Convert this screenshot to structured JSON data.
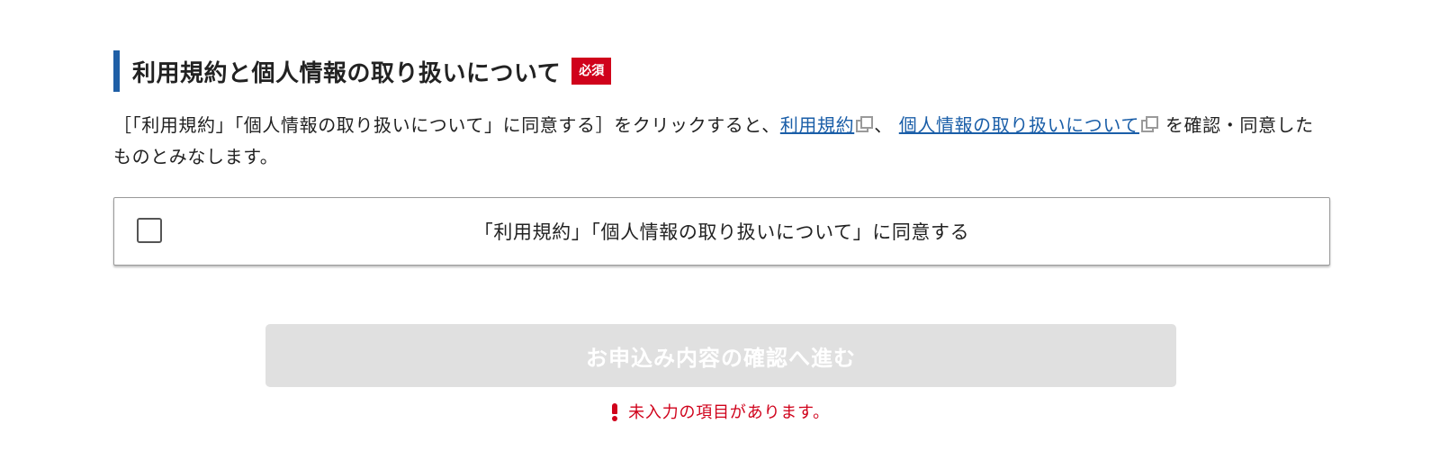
{
  "section": {
    "title": "利用規約と個人情報の取り扱いについて",
    "required_badge": "必須",
    "description_prefix": "［「利用規約」「個人情報の取り扱いについて」に同意する］をクリックすると、",
    "link_terms": "利用規約",
    "separator": "、 ",
    "link_privacy": "個人情報の取り扱いについて",
    "description_suffix": " を確認・同意したものとみなします。"
  },
  "agreement": {
    "label": "「利用規約」「個人情報の取り扱いについて」に同意する",
    "checked": false
  },
  "submit": {
    "label": "お申込み内容の確認へ進む",
    "enabled": false
  },
  "error": {
    "message": "未入力の項目があります。"
  },
  "colors": {
    "accent_bar": "#1f5fa6",
    "required_badge": "#d0021b",
    "link": "#1a5ea8",
    "disabled_button": "#e0e0e0",
    "error": "#d0021b"
  },
  "icons": [
    "external-link-icon",
    "checkbox-icon",
    "exclamation-icon"
  ]
}
